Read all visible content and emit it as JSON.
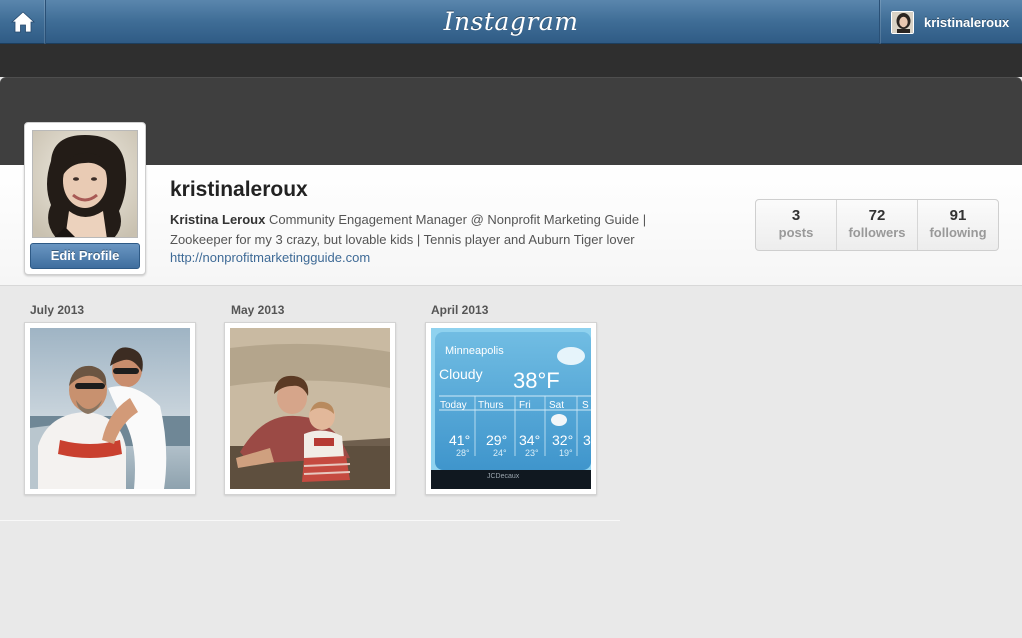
{
  "header": {
    "logo_text": "Instagram",
    "username": "kristinaleroux",
    "icons": {
      "home": "home-icon"
    }
  },
  "profile": {
    "username": "kristinaleroux",
    "full_name": "Kristina Leroux",
    "bio": "Community Engagement Manager @ Nonprofit Marketing Guide | Zookeeper for my 3 crazy, but lovable kids | Tennis player and Auburn Tiger lover",
    "website": "http://nonprofitmarketingguide.com",
    "edit_label": "Edit Profile"
  },
  "stats": [
    {
      "value": "3",
      "label": "posts"
    },
    {
      "value": "72",
      "label": "followers"
    },
    {
      "value": "91",
      "label": "following"
    }
  ],
  "photos": [
    {
      "month": "July 2013"
    },
    {
      "month": "May 2013"
    },
    {
      "month": "April 2013",
      "weather": {
        "city": "Minneapolis",
        "condition": "Cloudy",
        "temp": "38°F",
        "days": [
          "Today",
          "Thurs",
          "Fri",
          "Sat",
          "S"
        ],
        "highs": [
          "41°",
          "29°",
          "34°",
          "32°",
          "3"
        ],
        "lows": [
          "28°",
          "24°",
          "23°",
          "19°"
        ],
        "footer": "JCDecaux"
      }
    }
  ],
  "colors": {
    "topbar": "#3f6d96",
    "link": "#3e6a96",
    "button": "#4f7fae"
  }
}
